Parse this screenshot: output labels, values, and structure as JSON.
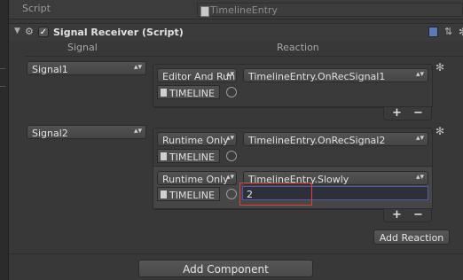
{
  "script_row": {
    "label": "Script",
    "value": "TimelineEntry"
  },
  "component": {
    "title": "Signal Receiver (Script)",
    "col_signal": "Signal",
    "col_reaction": "Reaction"
  },
  "signals": [
    {
      "name": "Signal1",
      "reactions": [
        {
          "mode": "Editor And Run",
          "method": "TimelineEntry.OnRecSignal1",
          "target": "TIMELINE"
        }
      ]
    },
    {
      "name": "Signal2",
      "reactions": [
        {
          "mode": "Runtime Only",
          "method": "TimelineEntry.OnRecSignal2",
          "target": "TIMELINE"
        },
        {
          "mode": "Runtime Only",
          "method": "TimelineEntry.Slowly",
          "target": "TIMELINE",
          "arg": "2"
        }
      ]
    }
  ],
  "buttons": {
    "add_reaction": "Add Reaction",
    "add_component": "Add Component",
    "plus": "+",
    "minus": "−"
  },
  "icons": {
    "dropdown": "▴▾",
    "gear": "✻"
  }
}
